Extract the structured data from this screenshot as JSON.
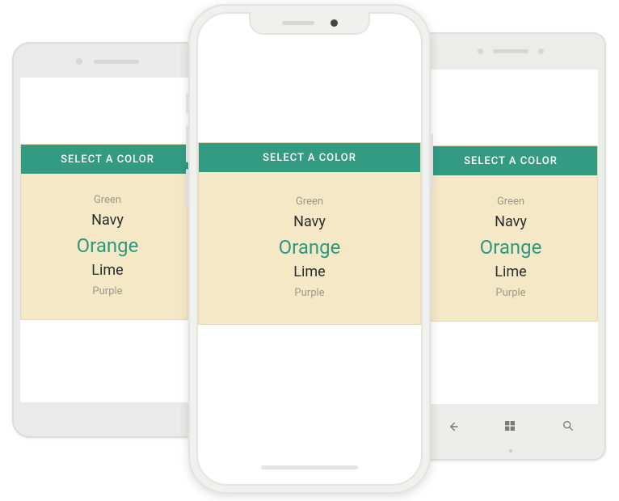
{
  "colors": {
    "accent": "#329b82",
    "card_bg": "#f5e8c7",
    "selected_text": "#2d9a80"
  },
  "picker": {
    "header": "SELECT A COLOR",
    "items": [
      "Green",
      "Navy",
      "Orange",
      "Lime",
      "Purple"
    ],
    "selected_index": 2
  },
  "devices": {
    "left": {
      "platform": "Android"
    },
    "center": {
      "platform": "iOS"
    },
    "right": {
      "platform": "Windows"
    }
  }
}
